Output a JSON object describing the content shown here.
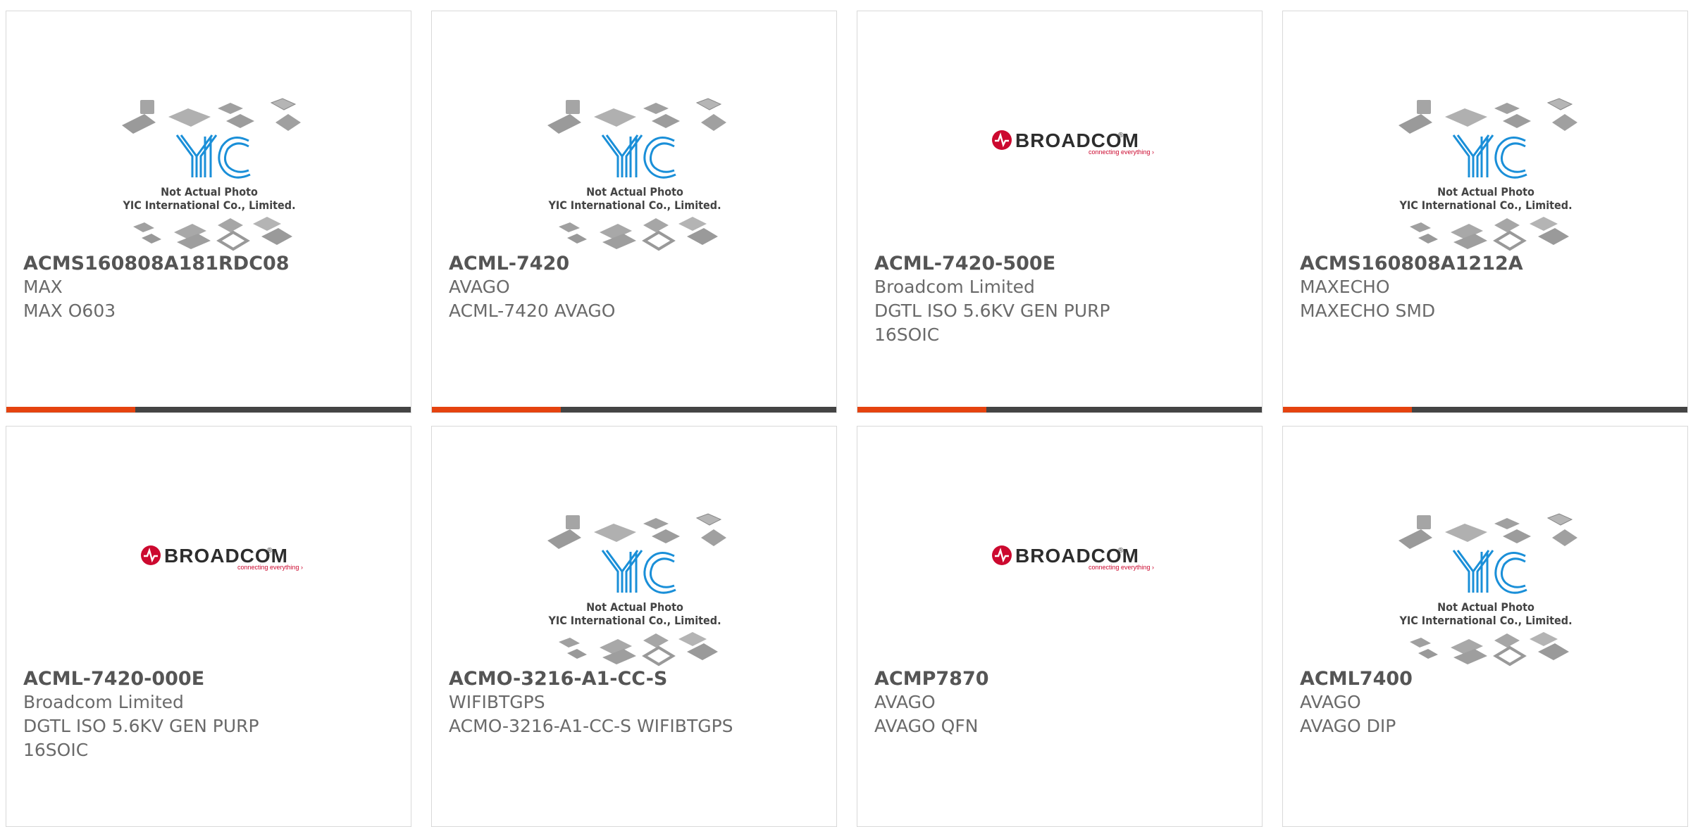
{
  "colors": {
    "accent": "#e5430f",
    "bar": "#444444",
    "yic_blue": "#1a8fd8",
    "broadcom_red": "#cc092f"
  },
  "placeholder": {
    "logo_text": "YIC",
    "line1": "Not Actual Photo",
    "line2": "YIC International Co., Limited."
  },
  "broadcom": {
    "name": "BROADCOM",
    "tagline": "connecting everything"
  },
  "products": [
    {
      "part": "ACMS160808A181RDC08",
      "maker": "MAX",
      "lines": [
        "MAX O603"
      ],
      "image": "yic-placeholder"
    },
    {
      "part": "ACML-7420",
      "maker": "AVAGO",
      "lines": [
        "ACML-7420 AVAGO"
      ],
      "image": "yic-placeholder"
    },
    {
      "part": "ACML-7420-500E",
      "maker": "Broadcom Limited",
      "lines": [
        "DGTL ISO 5.6KV GEN PURP",
        "16SOIC"
      ],
      "image": "broadcom-logo"
    },
    {
      "part": "ACMS160808A1212A",
      "maker": "MAXECHO",
      "lines": [
        "MAXECHO SMD"
      ],
      "image": "yic-placeholder"
    },
    {
      "part": "ACML-7420-000E",
      "maker": "Broadcom Limited",
      "lines": [
        "DGTL ISO 5.6KV GEN PURP",
        "16SOIC"
      ],
      "image": "broadcom-logo"
    },
    {
      "part": "ACMO-3216-A1-CC-S",
      "maker": "WIFIBTGPS",
      "lines": [
        "ACMO-3216-A1-CC-S WIFIBTGPS"
      ],
      "image": "yic-placeholder"
    },
    {
      "part": "ACMP7870",
      "maker": "AVAGO",
      "lines": [
        "AVAGO QFN"
      ],
      "image": "broadcom-logo"
    },
    {
      "part": "ACML7400",
      "maker": "AVAGO",
      "lines": [
        "AVAGO DIP"
      ],
      "image": "yic-placeholder"
    }
  ]
}
